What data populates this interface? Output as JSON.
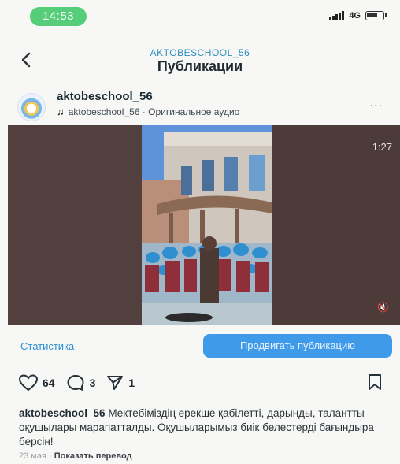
{
  "status_bar": {
    "time": "14:53",
    "network": "4G"
  },
  "header": {
    "account": "AKTOBESCHOOL_56",
    "title": "Публикации"
  },
  "post": {
    "username": "aktobeschool_56",
    "audio": "aktobeschool_56 · Оригинальное аудио",
    "more": "...",
    "video_duration": "1:27",
    "stats_label": "Статистика",
    "promote_label": "Продвигать публикацию",
    "likes": "64",
    "comments": "3",
    "shares": "1",
    "caption_user": "aktobeschool_56",
    "caption_text": "Мектебіміздің ерекше қабілетті, дарынды, талантты оқушылары марапатталды. Оқушыларымыз биік белестерді бағындыра берсін!",
    "date": "23 мая",
    "date_sep": " · ",
    "translate": "Показать перевод"
  },
  "colors": {
    "accent": "#3f9bea",
    "status_pill": "#56cd79",
    "link": "#2d8fd2"
  },
  "icons": [
    "back-icon",
    "music-note-icon",
    "more-icon",
    "heart-icon",
    "comment-icon",
    "send-icon",
    "bookmark-icon",
    "mute-icon"
  ]
}
